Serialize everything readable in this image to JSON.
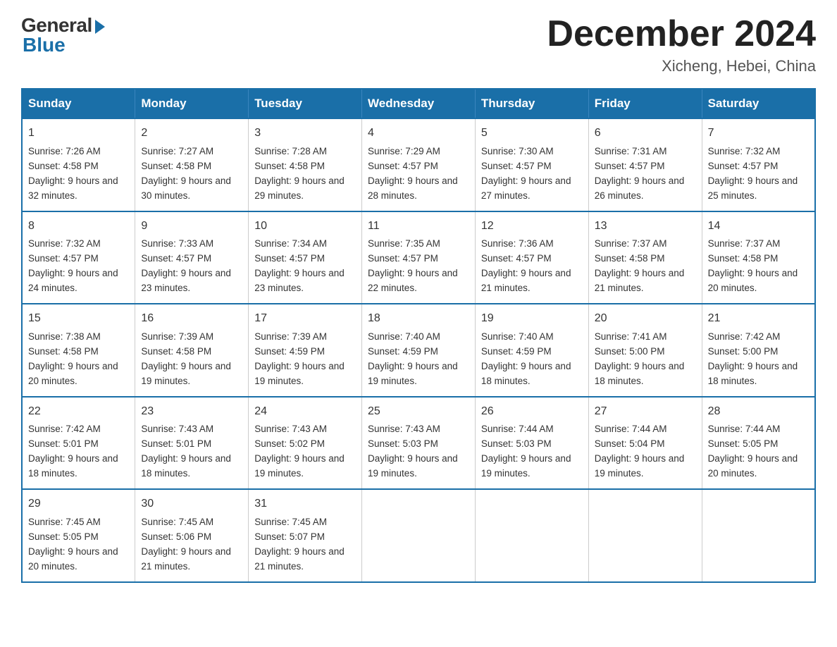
{
  "header": {
    "logo_general": "General",
    "logo_blue": "Blue",
    "month_title": "December 2024",
    "location": "Xicheng, Hebei, China"
  },
  "weekdays": [
    "Sunday",
    "Monday",
    "Tuesday",
    "Wednesday",
    "Thursday",
    "Friday",
    "Saturday"
  ],
  "weeks": [
    [
      {
        "day": "1",
        "sunrise": "Sunrise: 7:26 AM",
        "sunset": "Sunset: 4:58 PM",
        "daylight": "Daylight: 9 hours and 32 minutes."
      },
      {
        "day": "2",
        "sunrise": "Sunrise: 7:27 AM",
        "sunset": "Sunset: 4:58 PM",
        "daylight": "Daylight: 9 hours and 30 minutes."
      },
      {
        "day": "3",
        "sunrise": "Sunrise: 7:28 AM",
        "sunset": "Sunset: 4:58 PM",
        "daylight": "Daylight: 9 hours and 29 minutes."
      },
      {
        "day": "4",
        "sunrise": "Sunrise: 7:29 AM",
        "sunset": "Sunset: 4:57 PM",
        "daylight": "Daylight: 9 hours and 28 minutes."
      },
      {
        "day": "5",
        "sunrise": "Sunrise: 7:30 AM",
        "sunset": "Sunset: 4:57 PM",
        "daylight": "Daylight: 9 hours and 27 minutes."
      },
      {
        "day": "6",
        "sunrise": "Sunrise: 7:31 AM",
        "sunset": "Sunset: 4:57 PM",
        "daylight": "Daylight: 9 hours and 26 minutes."
      },
      {
        "day": "7",
        "sunrise": "Sunrise: 7:32 AM",
        "sunset": "Sunset: 4:57 PM",
        "daylight": "Daylight: 9 hours and 25 minutes."
      }
    ],
    [
      {
        "day": "8",
        "sunrise": "Sunrise: 7:32 AM",
        "sunset": "Sunset: 4:57 PM",
        "daylight": "Daylight: 9 hours and 24 minutes."
      },
      {
        "day": "9",
        "sunrise": "Sunrise: 7:33 AM",
        "sunset": "Sunset: 4:57 PM",
        "daylight": "Daylight: 9 hours and 23 minutes."
      },
      {
        "day": "10",
        "sunrise": "Sunrise: 7:34 AM",
        "sunset": "Sunset: 4:57 PM",
        "daylight": "Daylight: 9 hours and 23 minutes."
      },
      {
        "day": "11",
        "sunrise": "Sunrise: 7:35 AM",
        "sunset": "Sunset: 4:57 PM",
        "daylight": "Daylight: 9 hours and 22 minutes."
      },
      {
        "day": "12",
        "sunrise": "Sunrise: 7:36 AM",
        "sunset": "Sunset: 4:57 PM",
        "daylight": "Daylight: 9 hours and 21 minutes."
      },
      {
        "day": "13",
        "sunrise": "Sunrise: 7:37 AM",
        "sunset": "Sunset: 4:58 PM",
        "daylight": "Daylight: 9 hours and 21 minutes."
      },
      {
        "day": "14",
        "sunrise": "Sunrise: 7:37 AM",
        "sunset": "Sunset: 4:58 PM",
        "daylight": "Daylight: 9 hours and 20 minutes."
      }
    ],
    [
      {
        "day": "15",
        "sunrise": "Sunrise: 7:38 AM",
        "sunset": "Sunset: 4:58 PM",
        "daylight": "Daylight: 9 hours and 20 minutes."
      },
      {
        "day": "16",
        "sunrise": "Sunrise: 7:39 AM",
        "sunset": "Sunset: 4:58 PM",
        "daylight": "Daylight: 9 hours and 19 minutes."
      },
      {
        "day": "17",
        "sunrise": "Sunrise: 7:39 AM",
        "sunset": "Sunset: 4:59 PM",
        "daylight": "Daylight: 9 hours and 19 minutes."
      },
      {
        "day": "18",
        "sunrise": "Sunrise: 7:40 AM",
        "sunset": "Sunset: 4:59 PM",
        "daylight": "Daylight: 9 hours and 19 minutes."
      },
      {
        "day": "19",
        "sunrise": "Sunrise: 7:40 AM",
        "sunset": "Sunset: 4:59 PM",
        "daylight": "Daylight: 9 hours and 18 minutes."
      },
      {
        "day": "20",
        "sunrise": "Sunrise: 7:41 AM",
        "sunset": "Sunset: 5:00 PM",
        "daylight": "Daylight: 9 hours and 18 minutes."
      },
      {
        "day": "21",
        "sunrise": "Sunrise: 7:42 AM",
        "sunset": "Sunset: 5:00 PM",
        "daylight": "Daylight: 9 hours and 18 minutes."
      }
    ],
    [
      {
        "day": "22",
        "sunrise": "Sunrise: 7:42 AM",
        "sunset": "Sunset: 5:01 PM",
        "daylight": "Daylight: 9 hours and 18 minutes."
      },
      {
        "day": "23",
        "sunrise": "Sunrise: 7:43 AM",
        "sunset": "Sunset: 5:01 PM",
        "daylight": "Daylight: 9 hours and 18 minutes."
      },
      {
        "day": "24",
        "sunrise": "Sunrise: 7:43 AM",
        "sunset": "Sunset: 5:02 PM",
        "daylight": "Daylight: 9 hours and 19 minutes."
      },
      {
        "day": "25",
        "sunrise": "Sunrise: 7:43 AM",
        "sunset": "Sunset: 5:03 PM",
        "daylight": "Daylight: 9 hours and 19 minutes."
      },
      {
        "day": "26",
        "sunrise": "Sunrise: 7:44 AM",
        "sunset": "Sunset: 5:03 PM",
        "daylight": "Daylight: 9 hours and 19 minutes."
      },
      {
        "day": "27",
        "sunrise": "Sunrise: 7:44 AM",
        "sunset": "Sunset: 5:04 PM",
        "daylight": "Daylight: 9 hours and 19 minutes."
      },
      {
        "day": "28",
        "sunrise": "Sunrise: 7:44 AM",
        "sunset": "Sunset: 5:05 PM",
        "daylight": "Daylight: 9 hours and 20 minutes."
      }
    ],
    [
      {
        "day": "29",
        "sunrise": "Sunrise: 7:45 AM",
        "sunset": "Sunset: 5:05 PM",
        "daylight": "Daylight: 9 hours and 20 minutes."
      },
      {
        "day": "30",
        "sunrise": "Sunrise: 7:45 AM",
        "sunset": "Sunset: 5:06 PM",
        "daylight": "Daylight: 9 hours and 21 minutes."
      },
      {
        "day": "31",
        "sunrise": "Sunrise: 7:45 AM",
        "sunset": "Sunset: 5:07 PM",
        "daylight": "Daylight: 9 hours and 21 minutes."
      },
      null,
      null,
      null,
      null
    ]
  ]
}
